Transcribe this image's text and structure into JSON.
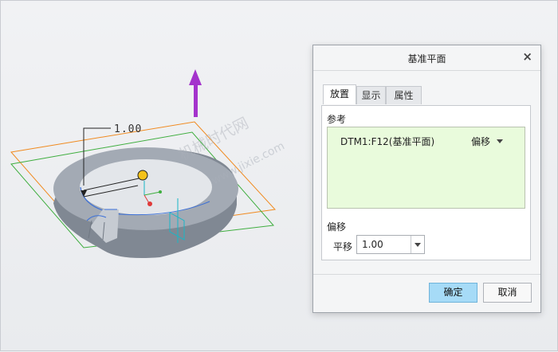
{
  "viewport": {
    "dimension_value": "1.00",
    "watermark_text": "机械时代网",
    "watermark_sub": "www.jixie.com",
    "colors": {
      "arrow": "#a433cc",
      "datum_orange": "#f08a1f",
      "datum_green": "#3fae3f",
      "ring_body": "#8f97a2",
      "highlight": "#3a6fd8"
    }
  },
  "dialog": {
    "title": "基准平面",
    "close_icon": "close-icon",
    "tabs": [
      {
        "label": "放置",
        "active": true
      },
      {
        "label": "显示",
        "active": false
      },
      {
        "label": "属性",
        "active": false
      }
    ],
    "references_label": "参考",
    "reference_item": "DTM1:F12(基准平面)",
    "reference_type": "偏移",
    "offset_section_label": "偏移",
    "translation_label": "平移",
    "offset_value": "1.00",
    "ok_label": "确定",
    "cancel_label": "取消"
  }
}
